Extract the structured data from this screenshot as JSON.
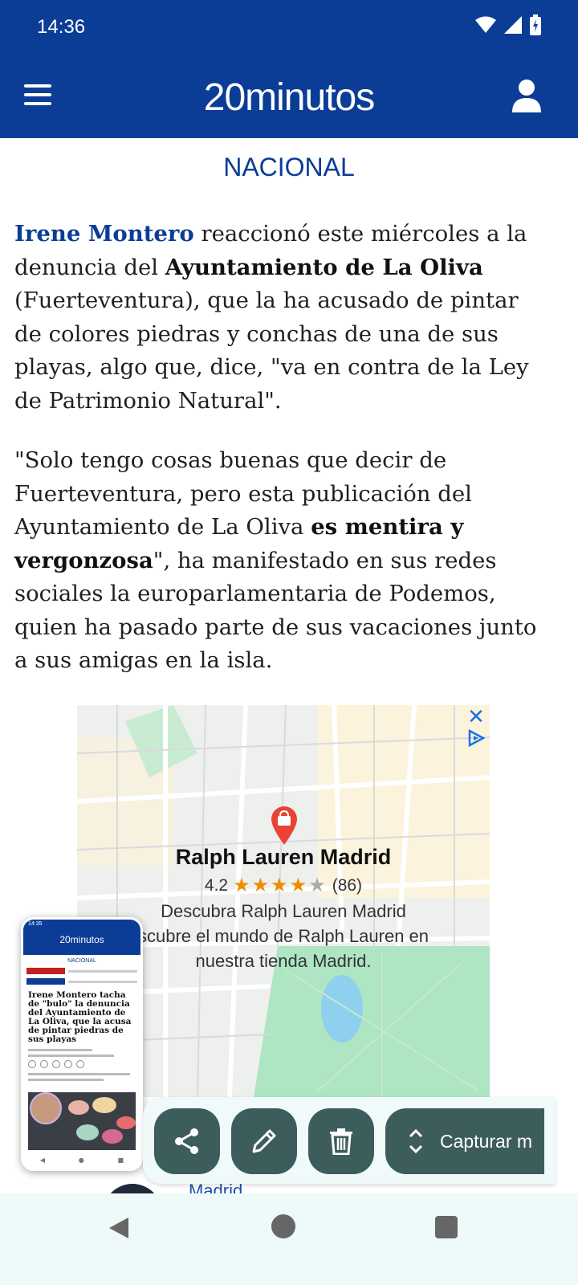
{
  "status_bar": {
    "time": "14:36"
  },
  "header": {
    "logo": "20minutos"
  },
  "section": "NACIONAL",
  "article": {
    "p1_link": "Irene Montero",
    "p1_a": " reaccionó este miércoles a la denuncia del ",
    "p1_bold": "Ayuntamiento de La Oliva",
    "p1_b": " (Fuerteventura), que la ha acusado de pintar de colores piedras y conchas de una de sus playas, algo que, dice, \"va en contra de la Ley de Patrimonio Natural\".",
    "p2_a": "\"Solo tengo cosas buenas que decir de Fuerteventura, pero esta publicación del Ayuntamiento de La Oliva ",
    "p2_bold": "es mentira y vergonzosa",
    "p2_b": "\", ha manifestado en sus redes sociales la europarlamentaria de Podemos, quien ha pasado parte de sus vacaciones junto a sus amigas en la isla."
  },
  "ad": {
    "store_name": "Ralph Lauren Madrid",
    "rating": "4.2",
    "rating_value": 4.2,
    "reviews": "(86)",
    "desc_line1": "Descubra Ralph Lauren Madrid",
    "desc_line2": "scubre el mundo de Ralph Lauren en",
    "desc_line3": "nuestra tienda Madrid."
  },
  "below_ad": {
    "partial_text": "Madrid"
  },
  "thumbnail": {
    "time": "14:35",
    "logo": "20minutos",
    "section": "NACIONAL",
    "title": "Irene Montero tacha de \"bulo\" la denuncia del Ayuntamiento de La Oliva, que la acusa de pintar piedras de sus playas"
  },
  "actions": {
    "capture_label": "Capturar m"
  },
  "colors": {
    "brand_blue": "#0b3d97",
    "action_button": "#3d5d5d",
    "star": "#f28b00"
  }
}
